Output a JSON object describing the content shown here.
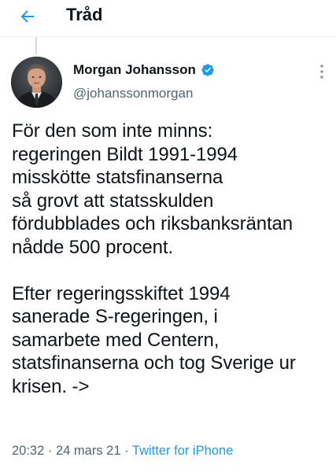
{
  "header": {
    "title": "Tråd"
  },
  "tweet": {
    "author": {
      "name": "Morgan Johansson",
      "handle": "@johanssonmorgan",
      "verified": true
    },
    "text": "För den som inte minns:\nregeringen Bildt 1991-1994\nmisskötte statsfinanserna\nså grovt att statsskulden\nfördubblades och riksbanksräntan\nnådde 500 procent.\n\nEfter regeringsskiftet 1994\nsanerade S-regeringen, i\nsamarbete med Centern,\nstatsfinanserna och tog Sverige ur\nkrisen. ->",
    "time": "20:32",
    "separator": "·",
    "date": "24 mars 21",
    "source": "Twitter for iPhone"
  },
  "colors": {
    "accent": "#1d9bf0",
    "text_primary": "#0f1419",
    "text_secondary": "#536471",
    "divider": "#eff3f4"
  },
  "icons": {
    "back": "arrow-left-icon",
    "verified": "verified-badge-icon",
    "more": "more-vertical-icon"
  }
}
